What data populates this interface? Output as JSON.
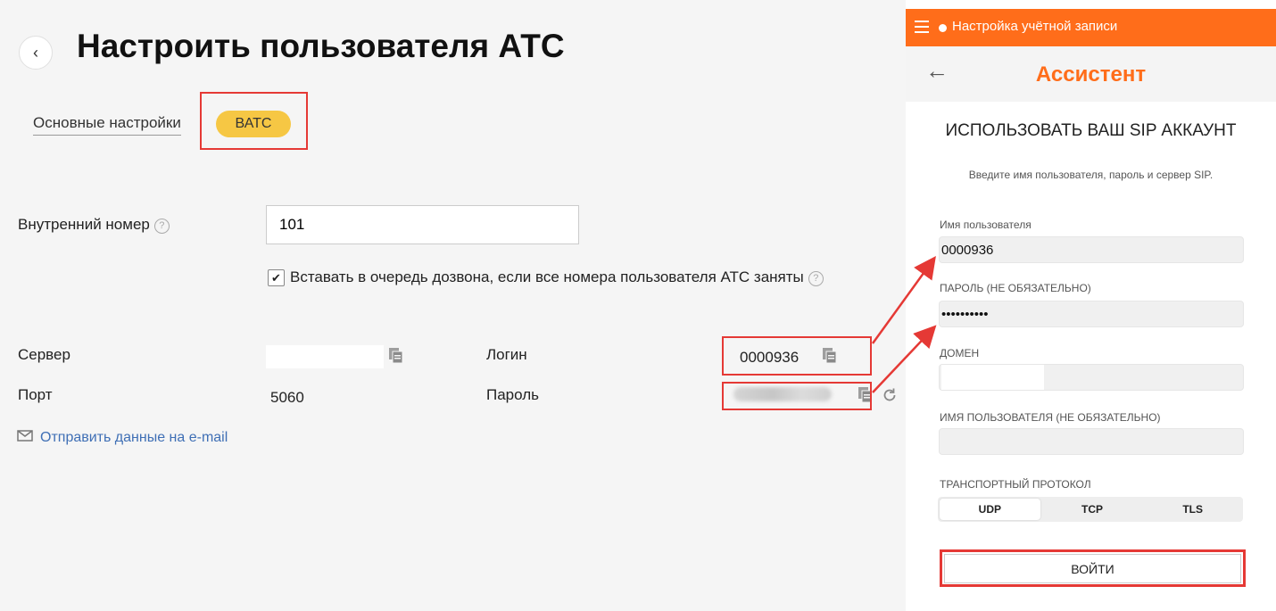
{
  "left": {
    "title": "Настроить пользователя АТС",
    "tabs": {
      "basic": "Основные настройки",
      "batc": "ВАТС"
    },
    "ext_label": "Внутренний номер",
    "ext_value": "101",
    "queue_checkbox_label": "Вставать в очередь дозвона, если все номера пользователя АТС заняты",
    "queue_checked": true,
    "server_label": "Сервер",
    "port_label": "Порт",
    "port_value": "5060",
    "login_label": "Логин",
    "login_value": "0000936",
    "password_label": "Пароль",
    "send_email": "Отправить данные на e-mail"
  },
  "right": {
    "topbar_title": "Настройка учётной записи",
    "header_title": "Ассистент",
    "section_title": "ИСПОЛЬЗОВАТЬ ВАШ SIP АККАУНТ",
    "section_subtitle": "Введите имя пользователя, пароль и сервер SIP.",
    "username_label": "Имя пользователя",
    "username_value": "0000936",
    "password_label": "ПАРОЛЬ (НЕ ОБЯЗАТЕЛЬНО)",
    "password_value": "••••••••••",
    "domain_label": "ДОМЕН",
    "display_name_label": "ИМЯ ПОЛЬЗОВАТЕЛЯ (НЕ ОБЯЗАТЕЛЬНО)",
    "transport_label": "ТРАНСПОРТНЫЙ ПРОТОКОЛ",
    "transport_options": [
      "UDP",
      "TCP",
      "TLS"
    ],
    "transport_selected": "UDP",
    "login_button": "ВОЙТИ"
  },
  "colors": {
    "accent_orange": "#ff6d1a",
    "tab_yellow": "#f6c744",
    "highlight_red": "#e53935",
    "link_blue": "#3f6fb5"
  },
  "icons": [
    "back-chevron-icon",
    "help-icon",
    "checkmark-icon",
    "copy-icon",
    "refresh-icon",
    "mail-icon",
    "hamburger-icon",
    "back-arrow-icon"
  ]
}
